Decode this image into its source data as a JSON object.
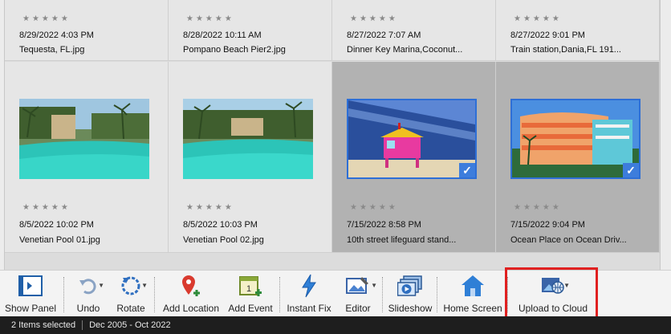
{
  "top_row": [
    {
      "rating": "★★★★★",
      "date": "8/29/2022 4:03 PM",
      "name": "Tequesta, FL.jpg",
      "selected": false
    },
    {
      "rating": "★★★★★",
      "date": "8/28/2022 10:11 AM",
      "name": "Pompano Beach Pier2.jpg",
      "selected": false
    },
    {
      "rating": "★★★★★",
      "date": "8/27/2022 7:07 AM",
      "name": "Dinner Key Marina,Coconut...",
      "selected": false
    },
    {
      "rating": "★★★★★",
      "date": "8/27/2022 9:01 PM",
      "name": "Train station,Dania,FL 191...",
      "selected": false
    }
  ],
  "main_row": [
    {
      "rating": "★★★★★",
      "date": "8/5/2022 10:02 PM",
      "name": "Venetian Pool 01.jpg",
      "selected": false
    },
    {
      "rating": "★★★★★",
      "date": "8/5/2022 10:03 PM",
      "name": "Venetian Pool 02.jpg",
      "selected": false
    },
    {
      "rating": "★★★★★",
      "date": "7/15/2022 8:58 PM",
      "name": "10th street lifeguard stand...",
      "selected": true
    },
    {
      "rating": "★★★★★",
      "date": "7/15/2022 9:04 PM",
      "name": "Ocean Place on Ocean Driv...",
      "selected": true
    }
  ],
  "check_glyph": "✓",
  "toolbar": {
    "show_panel": "Show Panel",
    "undo": "Undo",
    "rotate": "Rotate",
    "add_location": "Add Location",
    "add_event": "Add Event",
    "instant_fix": "Instant Fix",
    "editor": "Editor",
    "slideshow": "Slideshow",
    "home_screen": "Home Screen",
    "upload_to_cloud": "Upload to Cloud",
    "add_event_icon_text": "1"
  },
  "status": {
    "selection": "2 Items selected",
    "date_range": "Dec 2005 - Oct 2022"
  },
  "colors": {
    "selected_cell": "#b2b2b2",
    "selection_check": "#3d7ddc",
    "highlight": "#e02020",
    "status_bar": "#1e1e1e"
  },
  "icons": [
    "panel-icon",
    "undo-icon",
    "rotate-icon",
    "map-pin-icon",
    "calendar-icon",
    "lightning-icon",
    "editor-icon",
    "slideshow-icon",
    "home-icon",
    "cloud-upload-icon"
  ]
}
